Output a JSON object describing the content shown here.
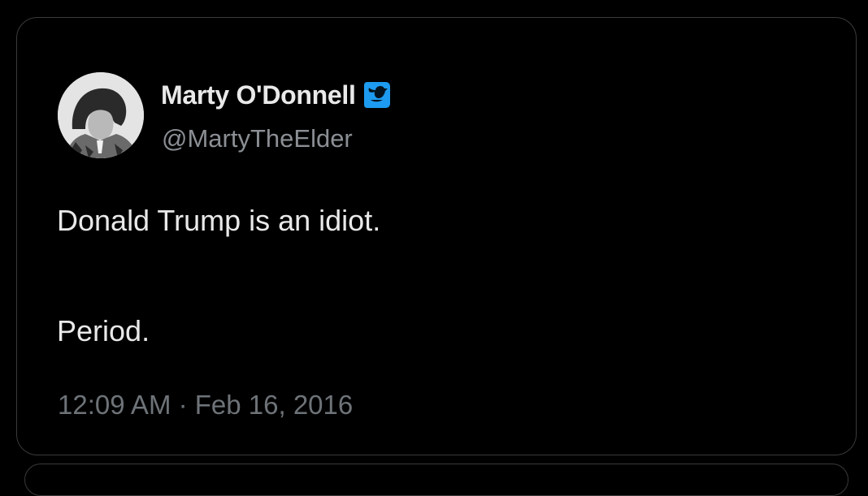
{
  "tweet": {
    "author": {
      "display_name": "Marty O'Donnell",
      "handle": "@MartyTheElder",
      "verified": true,
      "verified_badge_color": "#1d9bf0",
      "avatar_icon": "profile-photo"
    },
    "text_lines": [
      "Donald Trump is an idiot.",
      "Period."
    ],
    "timestamp": "12:09 AM · Feb 16, 2016"
  },
  "colors": {
    "background": "#000000",
    "card_border": "#3a3a3a",
    "text_primary": "#e9e9e9",
    "text_secondary": "#8b8f94"
  }
}
